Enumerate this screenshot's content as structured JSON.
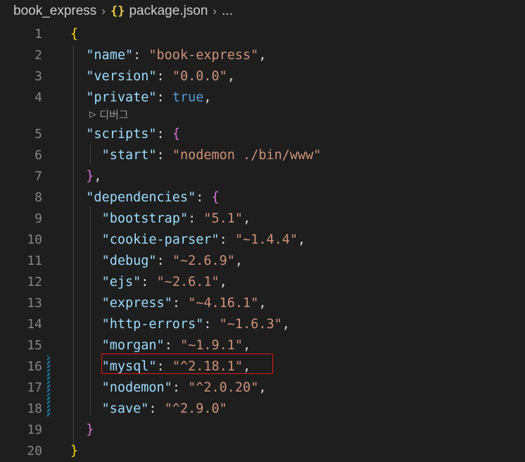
{
  "breadcrumb": {
    "folder": "book_express",
    "file_icon": "{}",
    "file": "package.json",
    "more": "..."
  },
  "codelens": {
    "label": "디버그"
  },
  "lines": [
    {
      "n": "1"
    },
    {
      "n": "2"
    },
    {
      "n": "3"
    },
    {
      "n": "4"
    },
    {
      "n": "5"
    },
    {
      "n": "6"
    },
    {
      "n": "7"
    },
    {
      "n": "8"
    },
    {
      "n": "9"
    },
    {
      "n": "10"
    },
    {
      "n": "11"
    },
    {
      "n": "12"
    },
    {
      "n": "13"
    },
    {
      "n": "14"
    },
    {
      "n": "15"
    },
    {
      "n": "16"
    },
    {
      "n": "17"
    },
    {
      "n": "18"
    },
    {
      "n": "19"
    },
    {
      "n": "20"
    }
  ],
  "code": {
    "open_brace": "{",
    "close_brace": "}",
    "name_key": "\"name\"",
    "name_val": "\"book-express\"",
    "version_key": "\"version\"",
    "version_val": "\"0.0.0\"",
    "private_key": "\"private\"",
    "private_val": "true",
    "scripts_key": "\"scripts\"",
    "start_key": "\"start\"",
    "start_val": "\"nodemon ./bin/www\"",
    "dependencies_key": "\"dependencies\"",
    "deps": [
      {
        "key": "\"bootstrap\"",
        "val": "\"5.1\""
      },
      {
        "key": "\"cookie-parser\"",
        "val": "\"~1.4.4\""
      },
      {
        "key": "\"debug\"",
        "val": "\"~2.6.9\""
      },
      {
        "key": "\"ejs\"",
        "val": "\"~2.6.1\""
      },
      {
        "key": "\"express\"",
        "val": "\"~4.16.1\""
      },
      {
        "key": "\"http-errors\"",
        "val": "\"~1.6.3\""
      },
      {
        "key": "\"morgan\"",
        "val": "\"~1.9.1\""
      },
      {
        "key": "\"mysql\"",
        "val": "\"^2.18.1\""
      },
      {
        "key": "\"nodemon\"",
        "val": "\"^2.0.20\""
      },
      {
        "key": "\"save\"",
        "val": "\"^2.9.0\""
      }
    ]
  },
  "colors": {
    "background": "#1e1e1e",
    "key": "#9cdcfe",
    "string": "#ce9178",
    "boolean": "#569cd6",
    "bracket_level1": "#ffd700",
    "bracket_level2": "#da70d6",
    "highlight_box": "#e01818"
  }
}
